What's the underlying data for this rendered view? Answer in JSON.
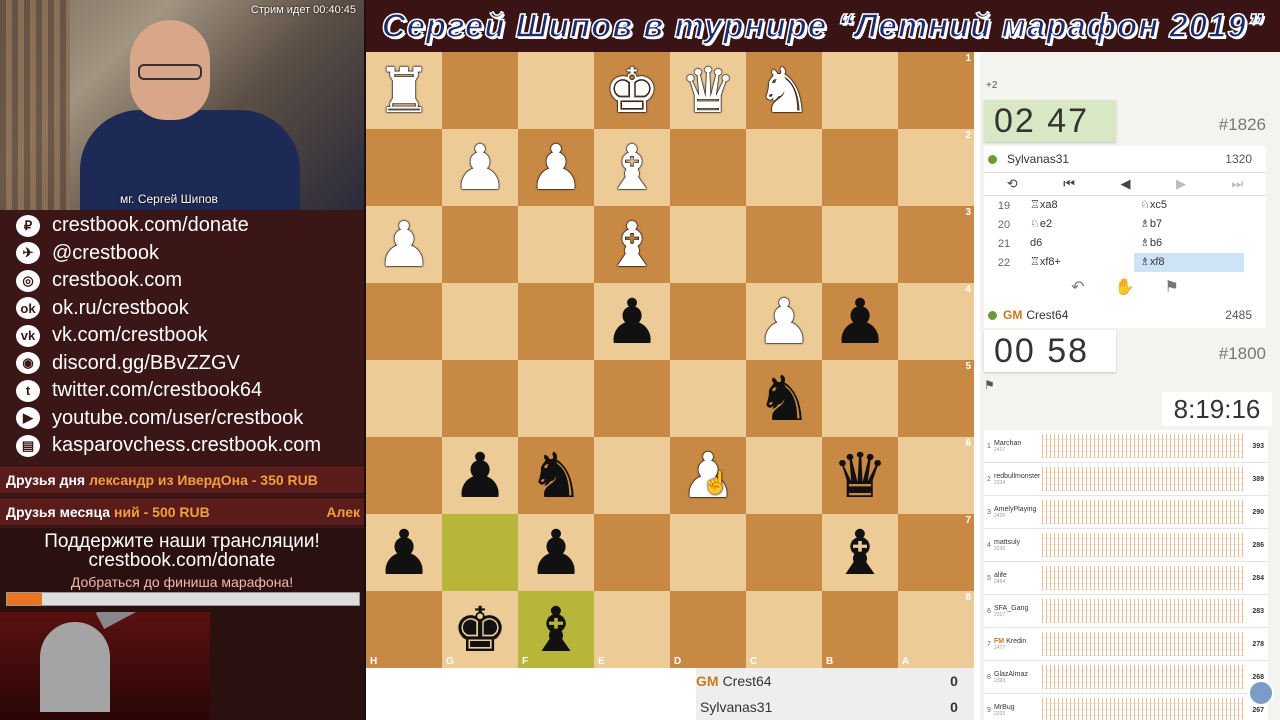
{
  "stream": {
    "live_status": "Стрим идет 00:40:45",
    "cam_caption": "мг. Сергей Шипов"
  },
  "links": [
    {
      "icon": "donate-icon",
      "glyph": "₽",
      "text": "crestbook.com/donate"
    },
    {
      "icon": "telegram-icon",
      "glyph": "✈",
      "text": "@crestbook"
    },
    {
      "icon": "globe-icon",
      "glyph": "◎",
      "text": "crestbook.com"
    },
    {
      "icon": "ok-icon",
      "glyph": "ok",
      "text": "ok.ru/crestbook"
    },
    {
      "icon": "vk-icon",
      "glyph": "vk",
      "text": "vk.com/crestbook"
    },
    {
      "icon": "discord-icon",
      "glyph": "◉",
      "text": "discord.gg/BBvZZGV"
    },
    {
      "icon": "twitter-icon",
      "glyph": "t",
      "text": "twitter.com/crestbook64"
    },
    {
      "icon": "youtube-icon",
      "glyph": "▶",
      "text": "youtube.com/user/crestbook"
    },
    {
      "icon": "chat-icon",
      "glyph": "▤",
      "text": "kasparovchess.crestbook.com"
    }
  ],
  "tickers": {
    "day_label": "Друзья дня",
    "day_text": "лександр из ИвердОна - 350 RUB",
    "month_label": "Друзья месяца",
    "month_text": "ний - 500 RUB",
    "month_tail": "Алек"
  },
  "support": {
    "line1": "Поддержите наши трансляции!",
    "line2": "crestbook.com/donate",
    "line3": "Добраться до финиша марафона!",
    "progress": 0.1
  },
  "banner": {
    "title": "Сергей Шипов в турнире “Летний марафон 2019”"
  },
  "board": {
    "ranks": [
      "1",
      "2",
      "3",
      "4",
      "5",
      "6",
      "7",
      "8"
    ],
    "files": [
      "H",
      "G",
      "F",
      "E",
      "D",
      "C",
      "B",
      "A"
    ],
    "squares": [
      [
        "wR",
        "",
        "",
        "wK",
        "wQ",
        "wN",
        "",
        ""
      ],
      [
        "",
        "wP",
        "wP",
        "wB",
        "",
        "",
        "",
        ""
      ],
      [
        "wP",
        "",
        "",
        "wB",
        "",
        "",
        "",
        ""
      ],
      [
        "",
        "",
        "",
        "bP",
        "",
        "wP",
        "bP",
        ""
      ],
      [
        "",
        "",
        "",
        "",
        "",
        "bN",
        "",
        ""
      ],
      [
        "",
        "bP",
        "bN",
        "",
        "wP",
        "",
        "bQ",
        ""
      ],
      [
        "bP",
        "",
        "bP",
        "",
        "",
        "",
        "bB",
        ""
      ],
      [
        "",
        "bK",
        "bB",
        "",
        "",
        "",
        "",
        ""
      ]
    ],
    "highlights": [
      "6-1",
      "7-2"
    ]
  },
  "scoreboard": [
    {
      "title": "GM",
      "name": "Crest64",
      "score": "0"
    },
    {
      "title": "",
      "name": "Sylvanas31",
      "score": "0"
    }
  ],
  "right": {
    "increment": "+2",
    "top_clock": "02 47",
    "top_game_id": "#1826",
    "top_player": {
      "title": "",
      "name": "Sylvanas31",
      "rating": "1320"
    },
    "moves": [
      {
        "n": "19",
        "w": "♖xa8",
        "b": "♘xc5"
      },
      {
        "n": "20",
        "w": "♘e2",
        "b": "♗b7"
      },
      {
        "n": "21",
        "w": "d6",
        "b": "♗b6"
      },
      {
        "n": "22",
        "w": "♖xf8+",
        "b": "♗xf8"
      }
    ],
    "bottom_player": {
      "title": "GM",
      "name": "Crest64",
      "rating": "2485"
    },
    "bottom_clock": "00 58",
    "bottom_game_id": "#1800",
    "marathon_clock": "8:19:16"
  },
  "standings": [
    {
      "pos": "1",
      "name": "Marchan",
      "rating": "2417",
      "score": "393",
      "title": ""
    },
    {
      "pos": "2",
      "name": "redbullmonster",
      "rating": "2334",
      "score": "389",
      "title": ""
    },
    {
      "pos": "3",
      "name": "AmelyPlaying",
      "rating": "2420",
      "score": "290",
      "title": ""
    },
    {
      "pos": "4",
      "name": "mattsuly",
      "rating": "2236",
      "score": "286",
      "title": ""
    },
    {
      "pos": "5",
      "name": "alife",
      "rating": "2484",
      "score": "284",
      "title": ""
    },
    {
      "pos": "6",
      "name": "SFA_Gang",
      "rating": "2317",
      "score": "283",
      "title": ""
    },
    {
      "pos": "7",
      "name": "Kredin",
      "rating": "2477",
      "score": "278",
      "title": "FM"
    },
    {
      "pos": "8",
      "name": "GlazAlmaz",
      "rating": "2393",
      "score": "268",
      "title": ""
    },
    {
      "pos": "9",
      "name": "MrBug",
      "rating": "2233",
      "score": "267",
      "title": ""
    }
  ],
  "colors": {
    "light_square": "#eccb97",
    "dark_square": "#c88945",
    "highlight": "#b7b53a",
    "accent": "#c77a1a"
  }
}
